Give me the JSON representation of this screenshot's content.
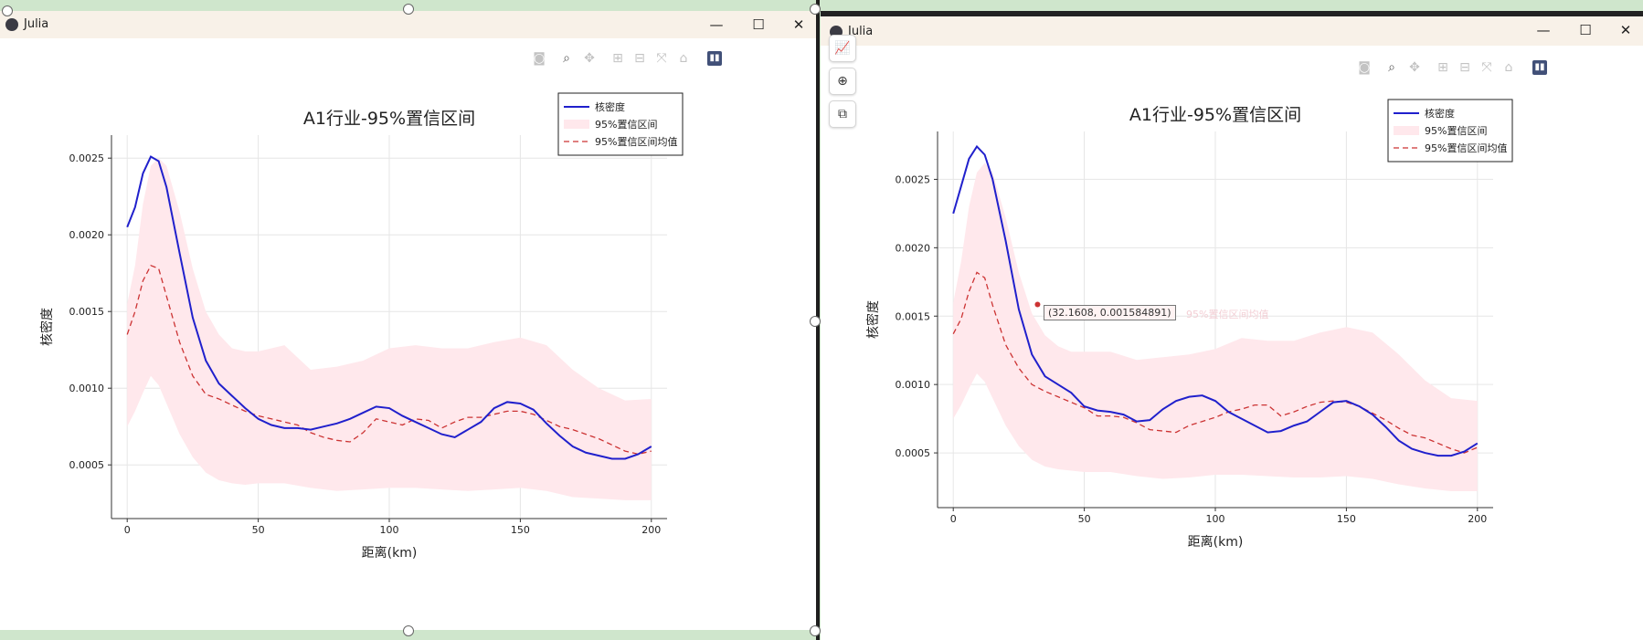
{
  "windows": [
    {
      "title": "Julia",
      "window_controls": [
        "—",
        "☐",
        "✕"
      ],
      "modebar": [
        "camera-icon",
        "zoom-icon",
        "pan-icon",
        "zoom-in-icon",
        "zoom-out-icon",
        "autoscale-icon",
        "reset-icon",
        "plotly-logo-icon"
      ],
      "plot": {
        "title": "A1行业-95%置信区间",
        "xlabel": "距离(km)",
        "ylabel": "核密度",
        "legend": [
          "核密度",
          "95%置信区间",
          "95%置信区间均值"
        ]
      }
    },
    {
      "title": "Julia",
      "window_controls": [
        "—",
        "☐",
        "✕"
      ],
      "modebar": [
        "camera-icon",
        "zoom-icon",
        "pan-icon",
        "zoom-in-icon",
        "zoom-out-icon",
        "autoscale-icon",
        "reset-icon",
        "plotly-logo-icon"
      ],
      "plot": {
        "title": "A1行业-95%置信区间",
        "xlabel": "距离(km)",
        "ylabel": "核密度",
        "legend": [
          "核密度",
          "95%置信区间",
          "95%置信区间均值"
        ]
      },
      "tooltip": {
        "text": "(32.1608, 0.001584891)",
        "series": "95%置信区间均值"
      }
    }
  ],
  "side_tools": [
    "chart-icon",
    "zoom-icon",
    "crop-icon"
  ],
  "colors": {
    "kde": "#2020cc",
    "band": "#ffe8ec",
    "mean": "#cc3333",
    "titlebar": "#f8f1e8"
  },
  "chart_data": [
    {
      "type": "line",
      "title": "A1行业-95%置信区间",
      "xlabel": "距离(km)",
      "ylabel": "核密度",
      "xlim": [
        -6,
        206
      ],
      "ylim": [
        0.00015,
        0.00265
      ],
      "xticks": [
        0,
        50,
        100,
        150,
        200
      ],
      "yticks": [
        0.0005,
        0.001,
        0.0015,
        0.002,
        0.0025
      ],
      "grid": true,
      "legend_position": "top-right",
      "series": [
        {
          "name": "核密度",
          "x": [
            0,
            3,
            6,
            9,
            12,
            15,
            20,
            25,
            30,
            35,
            40,
            45,
            50,
            55,
            60,
            65,
            70,
            75,
            80,
            85,
            90,
            95,
            100,
            105,
            110,
            115,
            120,
            125,
            130,
            135,
            140,
            145,
            150,
            155,
            160,
            165,
            170,
            175,
            180,
            185,
            190,
            195,
            200
          ],
          "y": [
            0.00205,
            0.00218,
            0.0024,
            0.00251,
            0.00248,
            0.00231,
            0.00188,
            0.00146,
            0.00118,
            0.00103,
            0.00095,
            0.00087,
            0.0008,
            0.00076,
            0.00074,
            0.00074,
            0.00073,
            0.00075,
            0.00077,
            0.0008,
            0.00084,
            0.00088,
            0.00087,
            0.00082,
            0.00078,
            0.00074,
            0.0007,
            0.00068,
            0.00073,
            0.00078,
            0.00087,
            0.00091,
            0.0009,
            0.00086,
            0.00077,
            0.00069,
            0.00062,
            0.00058,
            0.00056,
            0.00054,
            0.00054,
            0.00057,
            0.00062
          ]
        },
        {
          "name": "95%置信区间",
          "x": [
            0,
            3,
            6,
            9,
            12,
            15,
            20,
            25,
            30,
            35,
            40,
            45,
            50,
            60,
            70,
            80,
            90,
            100,
            110,
            120,
            130,
            140,
            150,
            160,
            170,
            180,
            190,
            200
          ],
          "upper": [
            0.00155,
            0.0018,
            0.0022,
            0.00245,
            0.0025,
            0.00245,
            0.00215,
            0.00178,
            0.0015,
            0.00135,
            0.00126,
            0.00124,
            0.00124,
            0.00128,
            0.00112,
            0.00114,
            0.00118,
            0.00126,
            0.00128,
            0.00126,
            0.00126,
            0.0013,
            0.00133,
            0.00128,
            0.00112,
            0.001,
            0.00092,
            0.00093
          ],
          "lower": [
            0.00075,
            0.00085,
            0.00097,
            0.00108,
            0.00102,
            0.0009,
            0.0007,
            0.00055,
            0.00045,
            0.0004,
            0.00038,
            0.00037,
            0.00038,
            0.00038,
            0.00035,
            0.00033,
            0.00034,
            0.00035,
            0.00035,
            0.00034,
            0.00033,
            0.00034,
            0.00035,
            0.00033,
            0.00029,
            0.00028,
            0.00027,
            0.00027
          ]
        },
        {
          "name": "95%置信区间均值",
          "x": [
            0,
            3,
            6,
            9,
            12,
            15,
            20,
            25,
            30,
            35,
            40,
            45,
            50,
            55,
            60,
            65,
            70,
            75,
            80,
            85,
            90,
            95,
            100,
            105,
            110,
            115,
            120,
            125,
            130,
            135,
            140,
            145,
            150,
            155,
            160,
            165,
            170,
            175,
            180,
            185,
            190,
            195,
            200
          ],
          "y": [
            0.00135,
            0.0015,
            0.0017,
            0.0018,
            0.00178,
            0.0016,
            0.0013,
            0.00108,
            0.00096,
            0.00093,
            0.00089,
            0.00085,
            0.00082,
            0.0008,
            0.00078,
            0.00076,
            0.00071,
            0.00068,
            0.00066,
            0.00065,
            0.00071,
            0.0008,
            0.00078,
            0.00076,
            0.0008,
            0.00079,
            0.00074,
            0.00078,
            0.00081,
            0.00081,
            0.00083,
            0.00085,
            0.00085,
            0.00083,
            0.00079,
            0.00075,
            0.00073,
            0.0007,
            0.00067,
            0.00063,
            0.00059,
            0.00057,
            0.00059
          ]
        }
      ]
    },
    {
      "type": "line",
      "title": "A1行业-95%置信区间",
      "xlabel": "距离(km)",
      "ylabel": "核密度",
      "xlim": [
        -6,
        206
      ],
      "ylim": [
        0.0001,
        0.00285
      ],
      "xticks": [
        0,
        50,
        100,
        150,
        200
      ],
      "yticks": [
        0.0005,
        0.001,
        0.0015,
        0.002,
        0.0025
      ],
      "grid": true,
      "legend_position": "top-right",
      "series": [
        {
          "name": "核密度",
          "x": [
            0,
            3,
            6,
            9,
            12,
            15,
            20,
            25,
            30,
            35,
            40,
            45,
            50,
            55,
            60,
            65,
            70,
            75,
            80,
            85,
            90,
            95,
            100,
            105,
            110,
            115,
            120,
            125,
            130,
            135,
            140,
            145,
            150,
            155,
            160,
            165,
            170,
            175,
            180,
            185,
            190,
            195,
            200
          ],
          "y": [
            0.00225,
            0.00245,
            0.00265,
            0.00274,
            0.00268,
            0.0025,
            0.00205,
            0.00155,
            0.00122,
            0.00106,
            0.001,
            0.00094,
            0.00084,
            0.00081,
            0.0008,
            0.00078,
            0.00073,
            0.00074,
            0.00082,
            0.00088,
            0.00091,
            0.00092,
            0.00088,
            0.0008,
            0.00075,
            0.0007,
            0.00065,
            0.00066,
            0.0007,
            0.00073,
            0.0008,
            0.00087,
            0.00088,
            0.00084,
            0.00078,
            0.00069,
            0.00059,
            0.00053,
            0.0005,
            0.00048,
            0.00048,
            0.00051,
            0.00057
          ]
        },
        {
          "name": "95%置信区间",
          "x": [
            0,
            3,
            6,
            9,
            12,
            15,
            20,
            25,
            30,
            35,
            40,
            45,
            50,
            60,
            70,
            80,
            90,
            100,
            110,
            120,
            130,
            140,
            150,
            160,
            170,
            180,
            190,
            200
          ],
          "upper": [
            0.0016,
            0.0019,
            0.0023,
            0.00255,
            0.00262,
            0.00255,
            0.00222,
            0.00182,
            0.00152,
            0.00136,
            0.00128,
            0.00124,
            0.00124,
            0.00124,
            0.00118,
            0.0012,
            0.00122,
            0.00126,
            0.00134,
            0.00132,
            0.00132,
            0.00138,
            0.00142,
            0.00138,
            0.00122,
            0.00103,
            0.0009,
            0.00088
          ],
          "lower": [
            0.00075,
            0.00085,
            0.00097,
            0.00108,
            0.00102,
            0.0009,
            0.0007,
            0.00055,
            0.00045,
            0.0004,
            0.00038,
            0.00037,
            0.00036,
            0.00036,
            0.00033,
            0.00031,
            0.00032,
            0.00034,
            0.00034,
            0.00033,
            0.00032,
            0.00032,
            0.00033,
            0.00031,
            0.00027,
            0.00024,
            0.00022,
            0.00022
          ]
        },
        {
          "name": "95%置信区间均值",
          "x": [
            0,
            3,
            6,
            9,
            12,
            15,
            20,
            25,
            30,
            35,
            40,
            45,
            50,
            55,
            60,
            65,
            70,
            75,
            80,
            85,
            90,
            95,
            100,
            105,
            110,
            115,
            120,
            125,
            130,
            135,
            140,
            145,
            150,
            155,
            160,
            165,
            170,
            175,
            180,
            185,
            190,
            195,
            200
          ],
          "y": [
            0.00137,
            0.00148,
            0.00168,
            0.00182,
            0.00178,
            0.00158,
            0.00129,
            0.00112,
            0.001,
            0.00095,
            0.00091,
            0.00087,
            0.00083,
            0.00077,
            0.00077,
            0.00076,
            0.00072,
            0.00067,
            0.00066,
            0.00065,
            0.0007,
            0.00073,
            0.00076,
            0.0008,
            0.00082,
            0.00085,
            0.00085,
            0.00077,
            0.0008,
            0.00084,
            0.00087,
            0.00088,
            0.00087,
            0.00084,
            0.00079,
            0.00074,
            0.00068,
            0.00063,
            0.00061,
            0.00057,
            0.00053,
            0.0005,
            0.00054
          ]
        }
      ]
    }
  ]
}
